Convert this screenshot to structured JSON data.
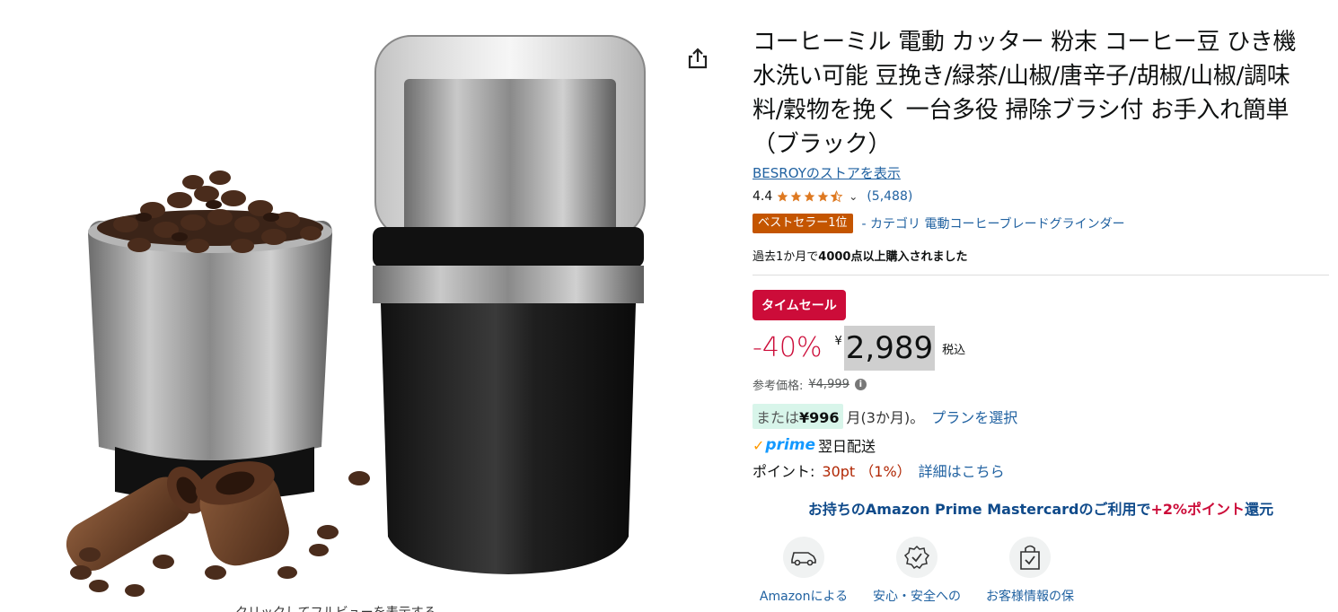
{
  "product": {
    "title": "コーヒーミル 電動 カッター 粉末 コーヒー豆 ひき機 水洗い可能 豆挽き/緑茶/山椒/唐辛子/胡椒/山椒/調味料/穀物を挽く 一台多役 掃除ブラシ付 お手入れ簡単（ブラック）",
    "store_link": "BESROYのストアを表示",
    "rating": "4.4",
    "rating_stars": 4.4,
    "review_count": "(5,488)",
    "bestseller_badge": "ベストセラー1位",
    "bestseller_category": "- カテゴリ 電動コーヒーブレードグラインダー",
    "bought_prefix": "過去1か月で",
    "bought_bold": "4000点以上購入されました"
  },
  "image": {
    "zoom_caption": "クリックしてフルビューを表示する",
    "share_icon": "share-icon"
  },
  "pricing": {
    "deal_badge": "タイムセール",
    "discount": "-40%",
    "currency": "¥",
    "price": "2,989",
    "tax_label": "税込",
    "ref_label": "参考価格:",
    "ref_price": "¥4,999",
    "installment_prefix": "または",
    "installment_amount": "¥996",
    "installment_months": "月(3か月)。",
    "plan_link": "プランを選択",
    "prime_label": "prime",
    "delivery": "翌日配送",
    "points_label": "ポイント:",
    "points_value": "30pt （1%）",
    "points_link": "詳細はこちら",
    "promo_main": "お持ちのAmazon Prime Mastercardのご利用で",
    "promo_accent": "+2%ポイント還元",
    "promo_suffix": "還元"
  },
  "features": [
    {
      "label": "Amazonによる",
      "icon": "delivery-truck-icon"
    },
    {
      "label": "安心・安全への",
      "icon": "safety-badge-icon"
    },
    {
      "label": "お客様情報の保",
      "icon": "secure-bag-icon"
    }
  ],
  "colors": {
    "link": "#2162a1",
    "deal_red": "#cc0c39",
    "bestseller_orange": "#c45500",
    "prime_blue": "#1399ff",
    "star": "#de7921"
  }
}
